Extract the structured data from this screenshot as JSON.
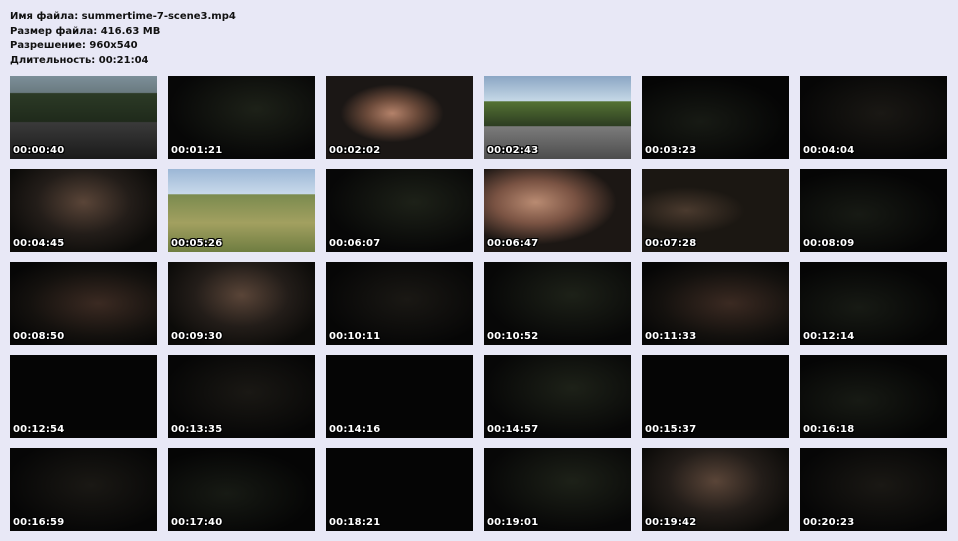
{
  "info": {
    "filename_line": "Имя файла: summertime-7-scene3.mp4",
    "filesize_line": "Размер файла: 416.63 MB",
    "resolution_line": "Разрешение: 960x540",
    "duration_line": "Длительность: 00:21:04"
  },
  "thumbnails": [
    {
      "time": "00:00:40"
    },
    {
      "time": "00:01:21"
    },
    {
      "time": "00:02:02"
    },
    {
      "time": "00:02:43"
    },
    {
      "time": "00:03:23"
    },
    {
      "time": "00:04:04"
    },
    {
      "time": "00:04:45"
    },
    {
      "time": "00:05:26"
    },
    {
      "time": "00:06:07"
    },
    {
      "time": "00:06:47"
    },
    {
      "time": "00:07:28"
    },
    {
      "time": "00:08:09"
    },
    {
      "time": "00:08:50"
    },
    {
      "time": "00:09:30"
    },
    {
      "time": "00:10:11"
    },
    {
      "time": "00:10:52"
    },
    {
      "time": "00:11:33"
    },
    {
      "time": "00:12:14"
    },
    {
      "time": "00:12:54"
    },
    {
      "time": "00:13:35"
    },
    {
      "time": "00:14:16"
    },
    {
      "time": "00:14:57"
    },
    {
      "time": "00:15:37"
    },
    {
      "time": "00:16:18"
    },
    {
      "time": "00:16:59"
    },
    {
      "time": "00:17:40"
    },
    {
      "time": "00:18:21"
    },
    {
      "time": "00:19:01"
    },
    {
      "time": "00:19:42"
    },
    {
      "time": "00:20:23"
    }
  ],
  "colors": {
    "background": "#e8e8f6",
    "thumbnail_background": "#050505",
    "timestamp_text": "#ffffff"
  }
}
